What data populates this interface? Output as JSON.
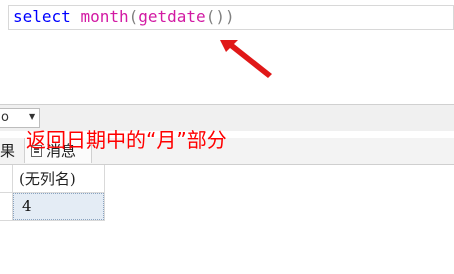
{
  "editor": {
    "code_tokens": {
      "select": "select",
      "month": "month",
      "open_paren": "(",
      "getdate": "getdate",
      "close_parens": "())"
    }
  },
  "toolbar": {
    "zoom_value": "o"
  },
  "annotation": {
    "text": "返回日期中的“月”部分",
    "color": "#ff0000"
  },
  "tabs": {
    "results_label": "果",
    "messages_label": "消息",
    "messages_icon": "message-icon"
  },
  "grid": {
    "column_header": "(无列名)",
    "rows": [
      {
        "value": "4"
      }
    ]
  },
  "colors": {
    "keyword": "#0000ff",
    "function": "#d21aa3",
    "punctuation": "#808080",
    "selected_cell": "#e4ecf5"
  }
}
